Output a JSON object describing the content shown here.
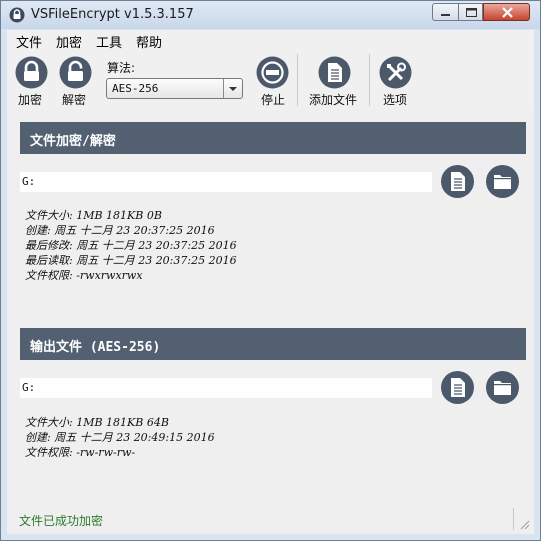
{
  "window": {
    "title": "VSFileEncrypt v1.5.3.157"
  },
  "menu": [
    "文件",
    "加密",
    "工具",
    "帮助"
  ],
  "toolbar": {
    "encrypt_label": "加密",
    "decrypt_label": "解密",
    "algorithm_label": "算法:",
    "algorithm_value": "AES-256",
    "stop_label": "停止",
    "add_file_label": "添加文件",
    "options_label": "选项"
  },
  "input_section": {
    "header": "文件加密/解密",
    "path": "G:",
    "info": [
      "文件大小: 1MB 181KB 0B",
      "创建: 周五 十二月 23 20:37:25 2016",
      "最后修改: 周五 十二月 23 20:37:25 2016",
      "最后读取: 周五 十二月 23 20:37:25 2016",
      "文件权限: -rwxrwxrwx"
    ]
  },
  "output_section": {
    "header": "输出文件 (AES-256)",
    "path": "G:",
    "info": [
      "文件大小: 1MB 181KB 64B",
      "创建: 周五 十二月 23 20:49:15 2016",
      "文件权限: -rw-rw-rw-"
    ]
  },
  "status": {
    "text": "文件已成功加密",
    "color": "#2c7a2c"
  },
  "colors": {
    "header_bg": "#526072",
    "icon_bg": "#4c596b"
  }
}
